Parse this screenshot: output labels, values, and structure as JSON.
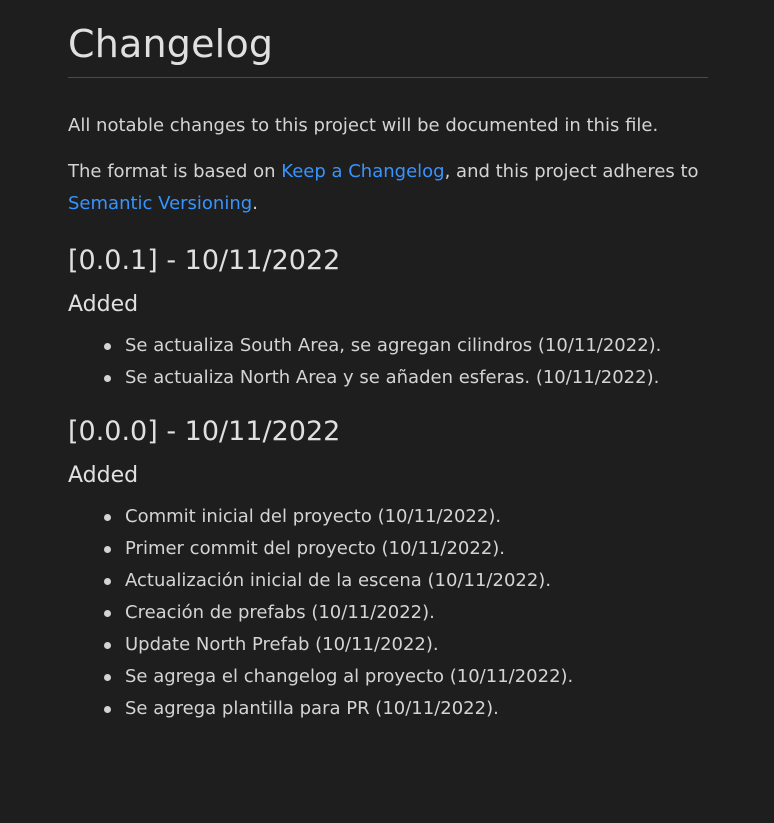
{
  "title": "Changelog",
  "intro": "All notable changes to this project will be documented in this file.",
  "format": {
    "prefix": "The format is based on ",
    "link1": "Keep a Changelog",
    "middle": ", and this project adheres to ",
    "link2": "Semantic Versioning",
    "suffix": "."
  },
  "releases": [
    {
      "heading": "[0.0.1] - 10/11/2022",
      "section": "Added",
      "items": [
        "Se actualiza South Area, se agregan cilindros (10/11/2022).",
        "Se actualiza North Area y se añaden esferas. (10/11/2022)."
      ]
    },
    {
      "heading": "[0.0.0] - 10/11/2022",
      "section": "Added",
      "items": [
        "Commit inicial del proyecto (10/11/2022).",
        "Primer commit del proyecto (10/11/2022).",
        "Actualización inicial de la escena (10/11/2022).",
        "Creación de prefabs (10/11/2022).",
        "Update North Prefab (10/11/2022).",
        "Se agrega el changelog al proyecto (10/11/2022).",
        "Se agrega plantilla para PR (10/11/2022)."
      ]
    }
  ]
}
